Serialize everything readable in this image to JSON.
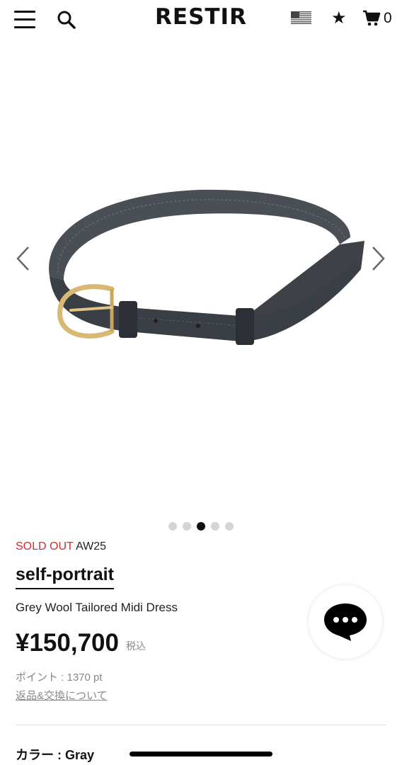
{
  "header": {
    "logo": "RESTIR",
    "menu_icon": "hamburger-menu-icon",
    "search_icon": "search-icon",
    "flag_icon": "us-flag-icon",
    "favorite_icon": "star-icon",
    "favorite_glyph": "★",
    "cart_icon": "cart-icon",
    "cart_count": "0"
  },
  "carousel": {
    "prev_icon": "chevron-left-icon",
    "next_icon": "chevron-right-icon",
    "slide_count": 5,
    "active_index": 2
  },
  "product": {
    "status": "SOLD OUT",
    "season": "AW25",
    "brand": "self-portrait",
    "name": "Grey Wool Tailored Midi Dress",
    "price": "¥150,700",
    "tax_label": "税込",
    "points": "ポイント : 1370 pt",
    "returns_link": "返品&交換について",
    "color_label": "カラー : Gray"
  },
  "chat": {
    "icon": "chat-bubble-icon"
  },
  "colors": {
    "sold_out": "#d8292b",
    "text": "#111111",
    "muted": "#888888",
    "dot_inactive": "#d4d4d4",
    "dot_active": "#111111"
  }
}
